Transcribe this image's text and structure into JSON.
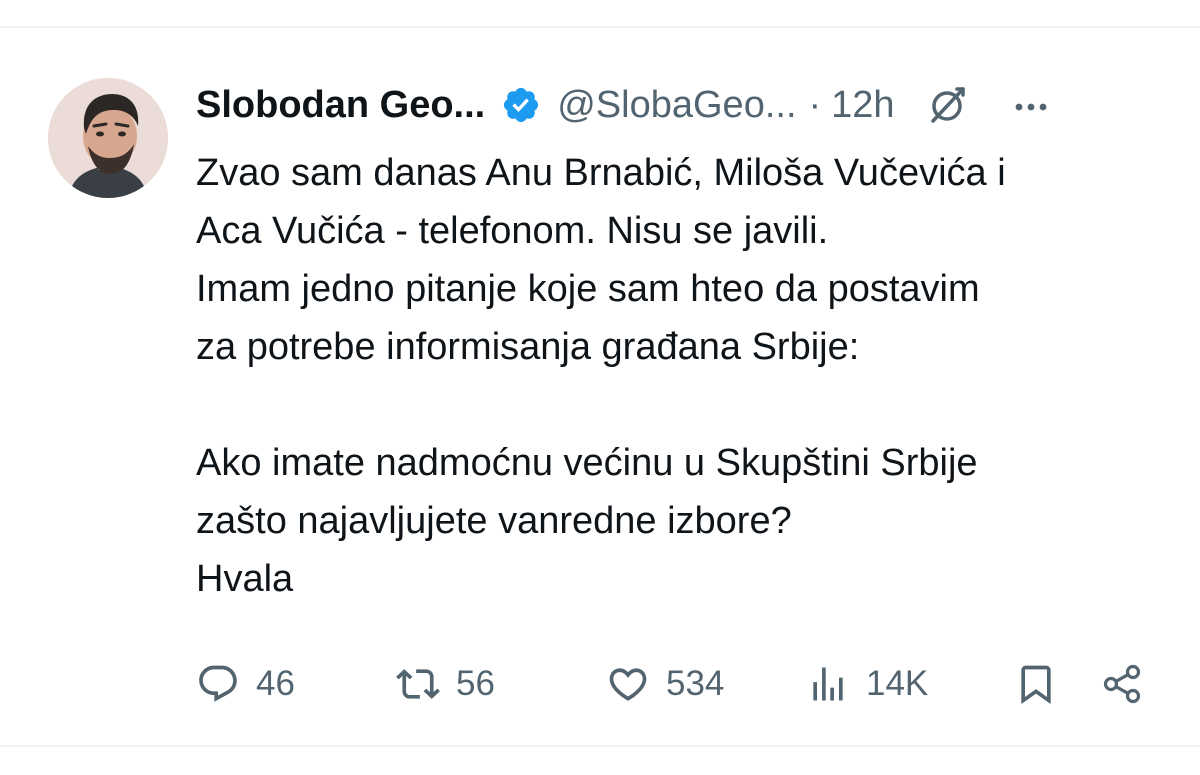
{
  "tweet": {
    "author": {
      "display_name": "Slobodan Geo...",
      "handle": "@SlobaGeo...",
      "verified": true,
      "avatar_icon": "avatar-photo"
    },
    "separator": "·",
    "time": "12h",
    "text_lines": [
      "Zvao sam danas Anu Brnabić, Miloša Vučevića i",
      "Aca Vučića - telefonom. Nisu se javili.",
      "Imam jedno pitanje koje sam hteo da postavim",
      "za potrebe informisanja građana Srbije:",
      "",
      "Ako imate nadmoćnu većinu u Skupštini Srbije",
      "zašto najavljujete vanredne izbore?",
      "Hvala"
    ],
    "stats": {
      "replies": "46",
      "reposts": "56",
      "likes": "534",
      "views": "14K"
    }
  },
  "icons": {
    "verified": "verified-badge-icon",
    "grok": "grok-icon",
    "more": "more-icon",
    "reply": "reply-icon",
    "repost": "repost-icon",
    "like": "heart-icon",
    "views": "views-icon",
    "bookmark": "bookmark-icon",
    "share": "share-icon"
  },
  "colors": {
    "text_primary": "#0f1419",
    "text_secondary": "#536471",
    "verified_blue": "#1d9bf0",
    "divider": "#eff3f4"
  }
}
